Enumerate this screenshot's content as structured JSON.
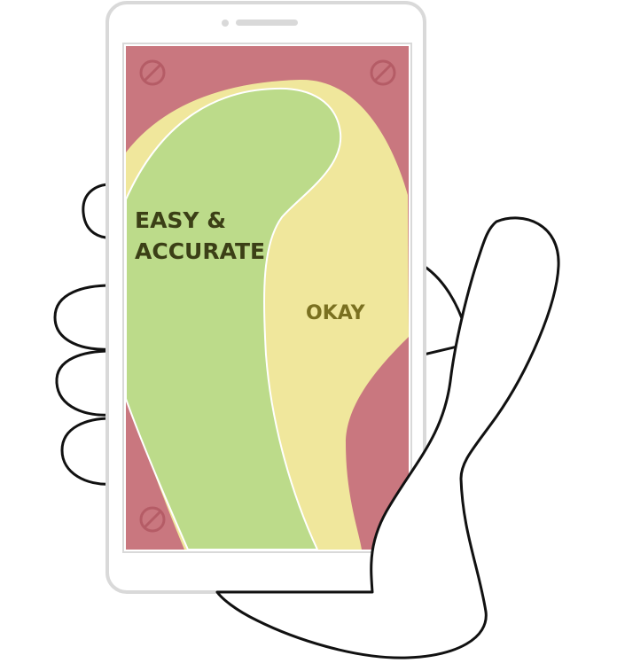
{
  "labels": {
    "easy_line1": "EASY &",
    "easy_line2": "ACCURATE",
    "okay": "OKAY"
  },
  "icons": [
    "no-entry-icon",
    "no-entry-icon",
    "no-entry-icon"
  ],
  "colors": {
    "hard_zone": "#c9777f",
    "okay_zone": "#f0e79c",
    "easy_zone": "#bcdb8a",
    "easy_text": "#3b3f16",
    "okay_text": "#7a7020",
    "icon": "#b55c66",
    "phone_frame": "#d9d9d9",
    "outline": "#111111"
  }
}
